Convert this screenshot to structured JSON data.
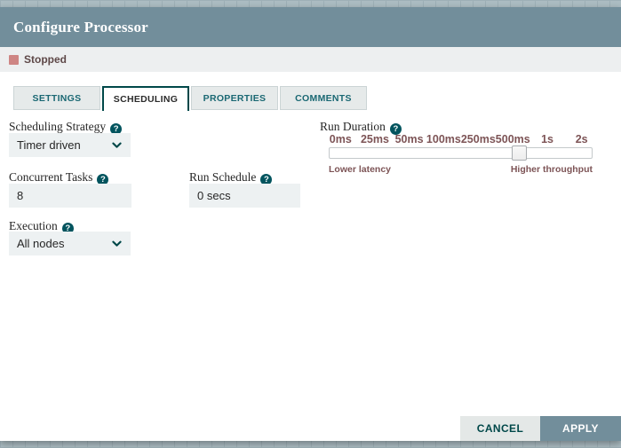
{
  "dialog": {
    "title": "Configure Processor"
  },
  "status": {
    "label": "Stopped",
    "state_color": "#CE8584"
  },
  "tabs": [
    {
      "label": "SETTINGS",
      "active": false
    },
    {
      "label": "SCHEDULING",
      "active": true
    },
    {
      "label": "PROPERTIES",
      "active": false
    },
    {
      "label": "COMMENTS",
      "active": false
    }
  ],
  "fields": {
    "scheduling_strategy": {
      "label": "Scheduling Strategy",
      "value": "Timer driven"
    },
    "concurrent_tasks": {
      "label": "Concurrent Tasks",
      "value": "8"
    },
    "run_schedule": {
      "label": "Run Schedule",
      "value": "0 secs"
    },
    "execution": {
      "label": "Execution",
      "value": "All nodes"
    },
    "run_duration": {
      "label": "Run Duration",
      "ticks": [
        "0ms",
        "25ms",
        "50ms",
        "100ms",
        "250ms",
        "500ms",
        "1s",
        "2s"
      ],
      "selected": "500ms",
      "left_hint": "Lower latency",
      "right_hint": "Higher throughput"
    }
  },
  "buttons": {
    "cancel": "CANCEL",
    "apply": "APPLY"
  },
  "icons": {
    "help": "?"
  },
  "colors": {
    "header": "#728E9B",
    "accent_teal": "#004849",
    "field_bg": "#EDF1F2",
    "tick_text": "#7D5456",
    "stopped_square": "#CE8584",
    "canvas": "#ACBDC3"
  }
}
